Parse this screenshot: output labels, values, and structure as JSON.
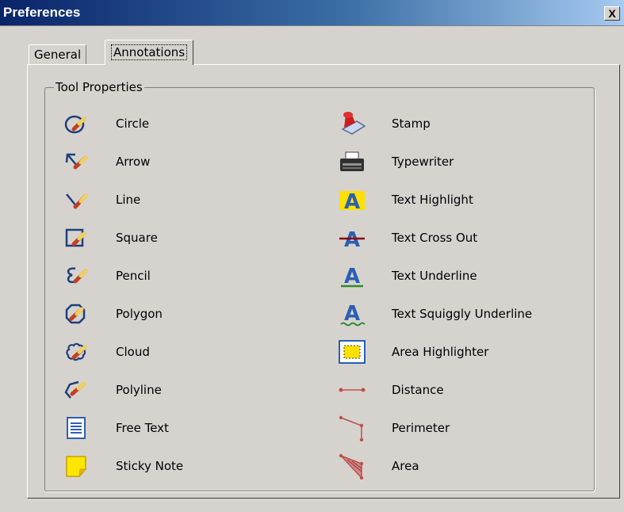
{
  "window": {
    "title": "Preferences",
    "close_label": "X"
  },
  "tabs": [
    {
      "label": "General",
      "selected": false
    },
    {
      "label": "Annotations",
      "selected": true
    }
  ],
  "group": {
    "label": "Tool Properties"
  },
  "tools_left": [
    {
      "label": "Circle",
      "icon": "circle-tool-icon"
    },
    {
      "label": "Arrow",
      "icon": "arrow-tool-icon"
    },
    {
      "label": "Line",
      "icon": "line-tool-icon"
    },
    {
      "label": "Square",
      "icon": "square-tool-icon"
    },
    {
      "label": "Pencil",
      "icon": "pencil-tool-icon"
    },
    {
      "label": "Polygon",
      "icon": "polygon-tool-icon"
    },
    {
      "label": "Cloud",
      "icon": "cloud-tool-icon"
    },
    {
      "label": "Polyline",
      "icon": "polyline-tool-icon"
    },
    {
      "label": "Free Text",
      "icon": "free-text-tool-icon"
    },
    {
      "label": "Sticky Note",
      "icon": "sticky-note-tool-icon"
    }
  ],
  "tools_right": [
    {
      "label": "Stamp",
      "icon": "stamp-tool-icon"
    },
    {
      "label": "Typewriter",
      "icon": "typewriter-tool-icon"
    },
    {
      "label": "Text Highlight",
      "icon": "text-highlight-tool-icon"
    },
    {
      "label": "Text Cross Out",
      "icon": "text-cross-out-tool-icon"
    },
    {
      "label": "Text Underline",
      "icon": "text-underline-tool-icon"
    },
    {
      "label": "Text Squiggly Underline",
      "icon": "text-squiggly-underline-tool-icon"
    },
    {
      "label": "Area Highlighter",
      "icon": "area-highlighter-tool-icon"
    },
    {
      "label": "Distance",
      "icon": "distance-tool-icon"
    },
    {
      "label": "Perimeter",
      "icon": "perimeter-tool-icon"
    },
    {
      "label": "Area",
      "icon": "area-tool-icon"
    }
  ],
  "colors": {
    "title_bar_start": "#0a246a",
    "title_bar_end": "#a6caf0",
    "dialog_background": "#d6d3ce",
    "highlight_yellow": "#ffe000",
    "measure_red": "#c0504d",
    "letter_blue": "#2b5fb4"
  }
}
